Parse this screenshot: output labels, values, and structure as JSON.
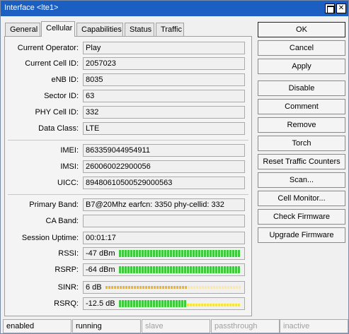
{
  "window": {
    "title": "Interface <lte1>"
  },
  "tabs": [
    {
      "label": "General",
      "active": false
    },
    {
      "label": "Cellular",
      "active": true
    },
    {
      "label": "Capabilities",
      "active": false
    },
    {
      "label": "Status",
      "active": false
    },
    {
      "label": "Traffic",
      "active": false
    }
  ],
  "fields": {
    "current_operator": {
      "label": "Current Operator:",
      "value": "Play"
    },
    "current_cell_id": {
      "label": "Current Cell ID:",
      "value": "2057023"
    },
    "enb_id": {
      "label": "eNB ID:",
      "value": "8035"
    },
    "sector_id": {
      "label": "Sector ID:",
      "value": "63"
    },
    "phy_cell_id": {
      "label": "PHY Cell ID:",
      "value": "332"
    },
    "data_class": {
      "label": "Data Class:",
      "value": "LTE"
    },
    "imei": {
      "label": "IMEI:",
      "value": "863359044954911"
    },
    "imsi": {
      "label": "IMSI:",
      "value": "260060022900056"
    },
    "uicc": {
      "label": "UICC:",
      "value": "89480610500529000563"
    },
    "primary_band": {
      "label": "Primary Band:",
      "value": "B7@20Mhz earfcn: 3350 phy-cellid: 332"
    },
    "ca_band": {
      "label": "CA Band:",
      "value": ""
    },
    "session_uptime": {
      "label": "Session Uptime:",
      "value": "00:01:17"
    }
  },
  "signal": {
    "rssi": {
      "label": "RSSI:",
      "value": "-47 dBm",
      "level": 1.0,
      "style": "full"
    },
    "rsrp": {
      "label": "RSRP:",
      "value": "-64 dBm",
      "level": 1.0,
      "style": "full"
    },
    "sinr": {
      "label": "SINR:",
      "value": "6 dB",
      "level": 0.6,
      "style": "thin"
    },
    "rsrq": {
      "label": "RSRQ:",
      "value": "-12.5 dB",
      "level": 0.55,
      "style": "mixed"
    }
  },
  "colors": {
    "meter_green": "#3ec93e",
    "meter_yellow": "#f5e642",
    "meter_orange": "#f0b32c",
    "titlebar": "#1b5fc2"
  },
  "buttons": {
    "ok": "OK",
    "cancel": "Cancel",
    "apply": "Apply",
    "disable": "Disable",
    "comment": "Comment",
    "remove": "Remove",
    "torch": "Torch",
    "reset_traffic_counters": "Reset Traffic Counters",
    "scan": "Scan...",
    "cell_monitor": "Cell Monitor...",
    "check_firmware": "Check Firmware",
    "upgrade_firmware": "Upgrade Firmware"
  },
  "status_bar": [
    "enabled",
    "running",
    "slave",
    "passthrough",
    "inactive"
  ]
}
